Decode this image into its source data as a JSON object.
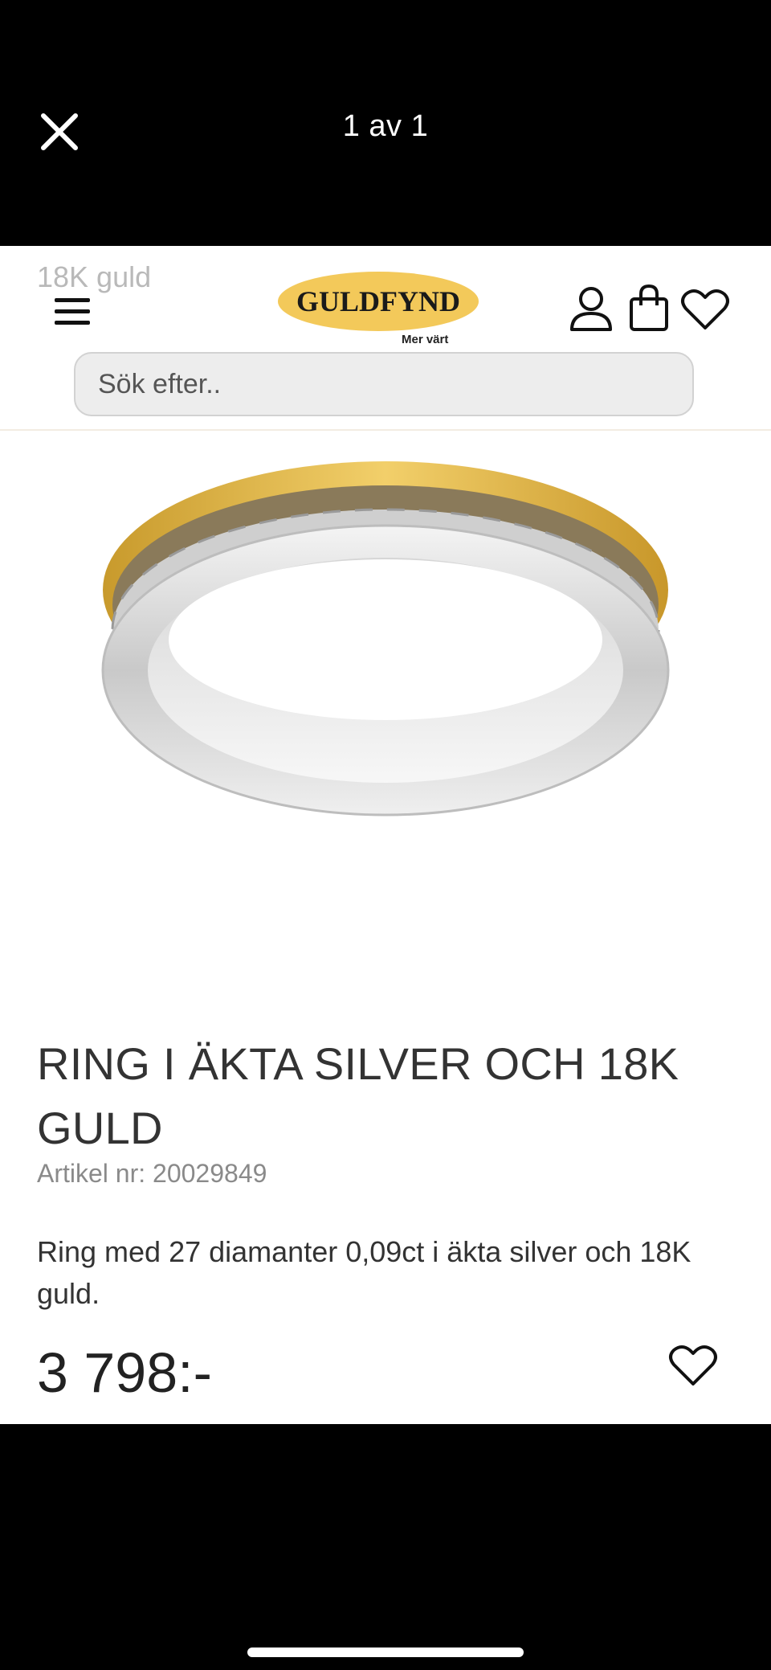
{
  "viewer": {
    "counter": "1 av 1",
    "close_icon": "close-icon"
  },
  "header": {
    "ghost_category": "18K guld",
    "logo_text": "GULDFYND",
    "logo_tagline": "Mer värt",
    "brand_color": "#f3c95a",
    "icons": [
      "menu-icon",
      "user-icon",
      "shopping-bag-icon",
      "heart-icon"
    ]
  },
  "search": {
    "placeholder": "Sök efter.."
  },
  "product": {
    "title": "RING I ÄKTA SILVER OCH 18K GULD",
    "article_number": "Artikel nr: 20029849",
    "description": "Ring med 27 diamanter 0,09ct i äkta silver och 18K guld.",
    "price": "3 798:-"
  }
}
